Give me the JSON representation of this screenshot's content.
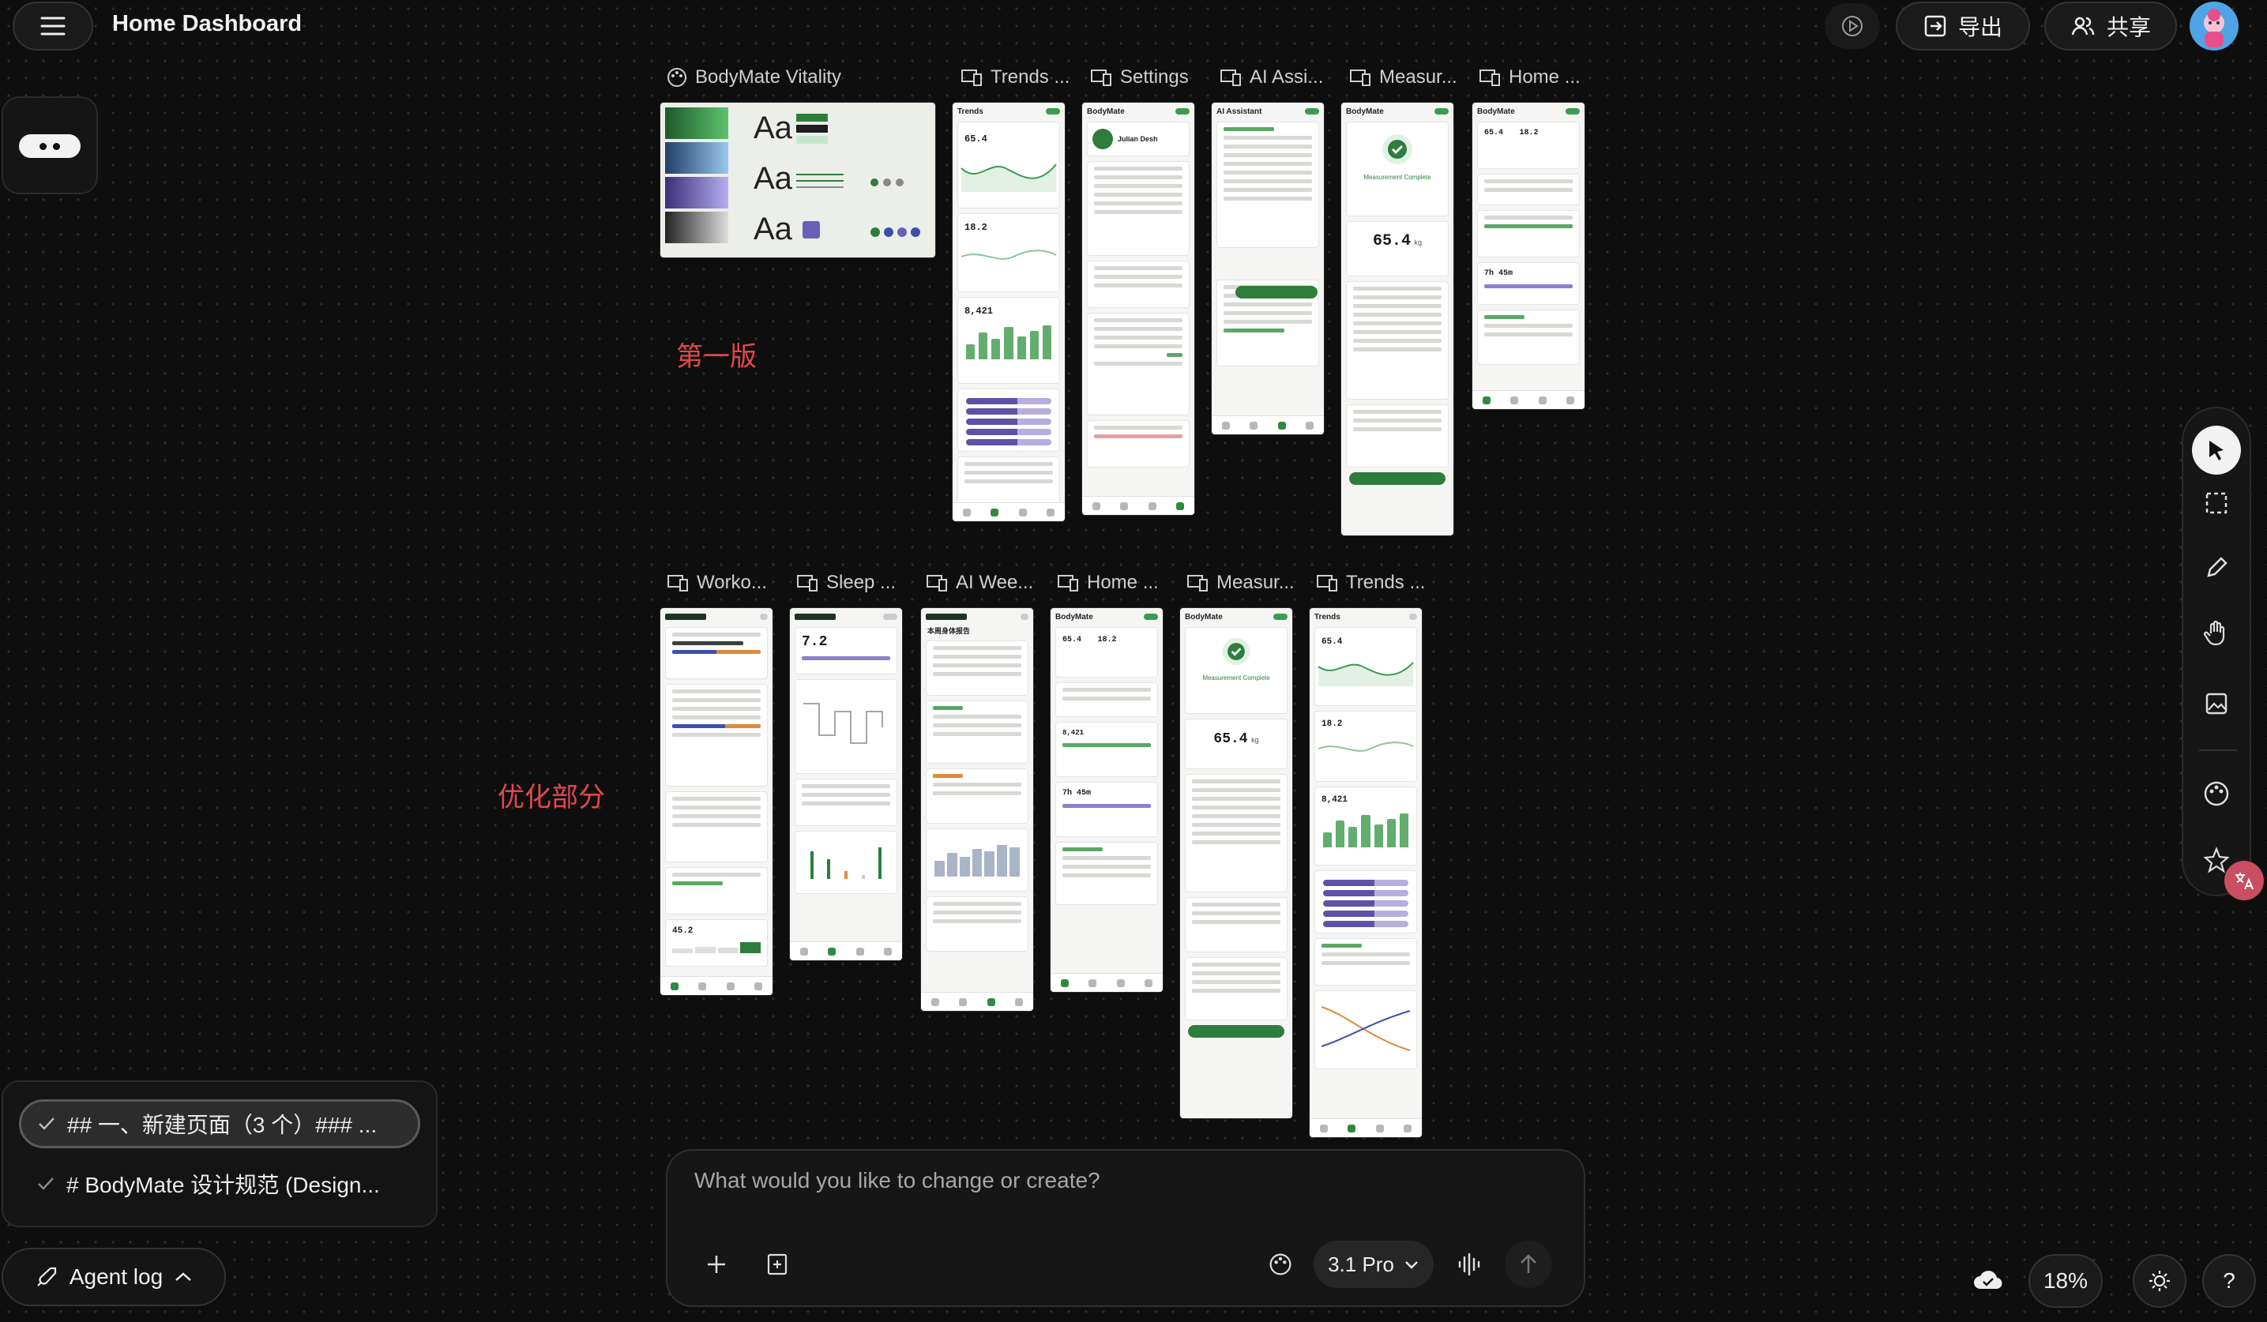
{
  "header": {
    "menu_icon": "hamburger-icon",
    "title": "Home Dashboard",
    "play_icon": "play-icon",
    "export_label": "导出",
    "share_label": "共享",
    "avatar_icon": "avatar-icon"
  },
  "left_tool": {
    "icon": "more-dots-icon"
  },
  "frame_labels": {
    "row1": [
      "BodyMate Vitality",
      "Trends ...",
      "Settings",
      "AI Assi...",
      "Measur...",
      "Home ..."
    ],
    "row2": [
      "Worko...",
      "Sleep ...",
      "AI Wee...",
      "Home ...",
      "Measur...",
      "Trends ..."
    ]
  },
  "annotations": {
    "v1": "第一版",
    "optimized": "优化部分"
  },
  "frames": {
    "design_system": {
      "type_samples": [
        "Aa",
        "Aa",
        "Aa"
      ]
    },
    "trends": {
      "title": "Trends",
      "weight": "65.4",
      "bodyfat": "18.2",
      "steps": "8,421"
    },
    "settings": {
      "title": "BodyMate",
      "user": "Julian Desh"
    },
    "ai_assistant": {
      "title": "AI Assistant"
    },
    "measure": {
      "title": "BodyMate",
      "status": "Measurement Complete",
      "weight": "65.4",
      "unit": "kg"
    },
    "home": {
      "title": "BodyMate",
      "weight": "65.4",
      "bodyfat": "18.2",
      "steps": "8,421",
      "sleep": "7h 45m"
    },
    "sleep": {
      "value": "7.2"
    },
    "ai_weekly": {
      "title": "本周身体报告"
    },
    "workout": {
      "value": "45.2"
    }
  },
  "right_toolbar": {
    "tools": [
      "cursor-icon",
      "select-area-icon",
      "pencil-icon",
      "hand-icon",
      "image-icon",
      "palette-icon",
      "star-icon"
    ]
  },
  "agent_log": {
    "items": [
      {
        "text": "## 一、新建页面（3 个）### ...",
        "selected": true
      },
      {
        "text": "# BodyMate 设计规范 (Design...",
        "selected": false
      }
    ],
    "button_label": "Agent log"
  },
  "prompt": {
    "placeholder": "What would you like to change or create?",
    "model": "3.1 Pro"
  },
  "bottom_right": {
    "zoom": "18%",
    "help": "?"
  },
  "colors": {
    "accent_green": "#2f7d3c",
    "annotation_red": "#e5484d",
    "purple": "#6b5fb8"
  }
}
